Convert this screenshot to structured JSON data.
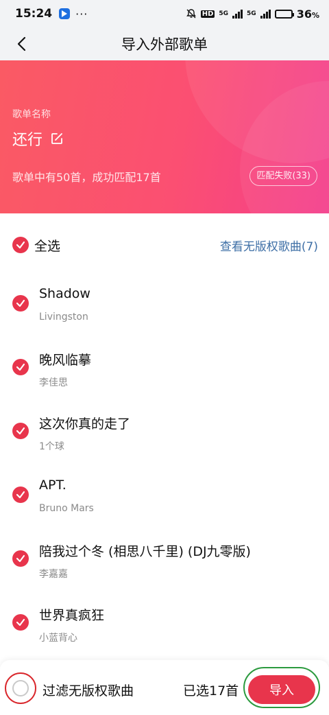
{
  "status_bar": {
    "time": "15:24",
    "network_1": "5G",
    "network_2": "5G",
    "hd_badge": "HD",
    "battery_percent": "36",
    "battery_unit": "%",
    "battery_level": 0.36
  },
  "nav": {
    "title": "导入外部歌单"
  },
  "playlist": {
    "label": "歌单名称",
    "name": "还行",
    "match_info": "歌单中有50首，成功匹配17首",
    "fail_button": "匹配失败(33)"
  },
  "select_all": {
    "label": "全选",
    "no_copyright_link": "查看无版权歌曲(7)"
  },
  "songs": [
    {
      "title": "Shadow",
      "artist": "Livingston"
    },
    {
      "title": "晚风临摹",
      "artist": "李佳思"
    },
    {
      "title": "这次你真的走了",
      "artist": "1个球"
    },
    {
      "title": "APT.",
      "artist": "Bruno Mars"
    },
    {
      "title": "陪我过个冬 (相思八千里) (DJ九零版)",
      "artist": "李嘉嘉"
    },
    {
      "title": "世界真疯狂",
      "artist": "小蓝背心"
    }
  ],
  "bottom": {
    "filter_label": "过滤无版权歌曲",
    "selected_count": "已选17首",
    "import_button": "导入"
  },
  "colors": {
    "accent": "#e8354c",
    "link": "#3e6fa6",
    "header_start": "#fa5a64",
    "header_end": "#f43e8c"
  }
}
